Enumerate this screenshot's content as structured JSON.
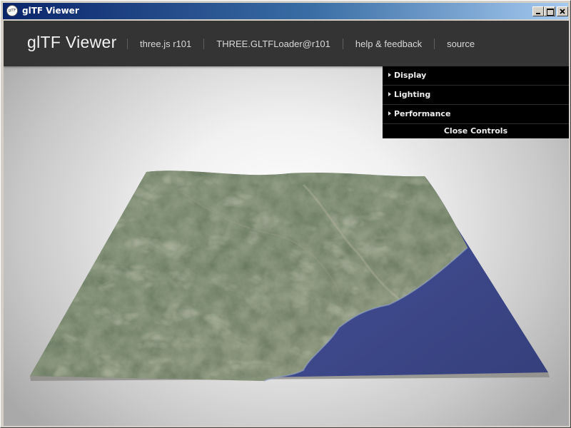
{
  "window": {
    "title": "glTF Viewer",
    "app_icon_text": "glTF"
  },
  "header": {
    "title": "glTF Viewer",
    "links": [
      "three.js r101",
      "THREE.GLTFLoader@r101",
      "help & feedback",
      "source"
    ]
  },
  "controls": {
    "folders": [
      "Display",
      "Lighting",
      "Performance"
    ],
    "close_label": "Close Controls"
  },
  "colors": {
    "header_bg": "#343434",
    "controls_bg": "#000000",
    "titlebar_start": "#0a246a",
    "titlebar_end": "#a6caf0",
    "sea": "#3d4a8a",
    "terrain": "#4b5a45"
  }
}
